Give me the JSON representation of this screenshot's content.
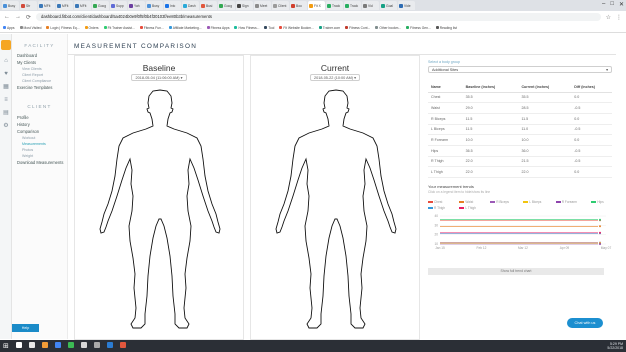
{
  "browser": {
    "tabs": [
      {
        "label": "Busy",
        "color": "#4a90d9",
        "active": false
      },
      {
        "label": "Str",
        "color": "#d24b3c",
        "active": false
      },
      {
        "label": "MFit",
        "color": "#3b78b8",
        "active": false
      },
      {
        "label": "MFit",
        "color": "#3b78b8",
        "active": false
      },
      {
        "label": "MFit",
        "color": "#3b78b8",
        "active": false
      },
      {
        "label": "Goog",
        "color": "#34a853",
        "active": false
      },
      {
        "label": "Supp",
        "color": "#5f6bd6",
        "active": false
      },
      {
        "label": "Yah",
        "color": "#6b3fa0",
        "active": false
      },
      {
        "label": "Busy",
        "color": "#4a90d9",
        "active": false
      },
      {
        "label": "Intc",
        "color": "#1a73e8",
        "active": false
      },
      {
        "label": "Dash",
        "color": "#29a9d8",
        "active": false
      },
      {
        "label": "Busi",
        "color": "#e1573d",
        "active": false
      },
      {
        "label": "Goog",
        "color": "#34a853",
        "active": false
      },
      {
        "label": "Sign",
        "color": "#444444",
        "active": false
      },
      {
        "label": "Meet",
        "color": "#8b8b8b",
        "active": false
      },
      {
        "label": "Client",
        "color": "#9a9a9a",
        "active": false
      },
      {
        "label": "Boo",
        "color": "#d13f2c",
        "active": false
      },
      {
        "label": "Fit X",
        "color": "#f39c12",
        "active": true
      },
      {
        "label": "Track",
        "color": "#27ae60",
        "active": false
      },
      {
        "label": "Track",
        "color": "#27ae60",
        "active": false
      },
      {
        "label": "Vid",
        "color": "#7a7a7a",
        "active": false
      },
      {
        "label": "Goal",
        "color": "#16a085",
        "active": false
      },
      {
        "label": "Vide",
        "color": "#2d6cb3",
        "active": false
      }
    ],
    "url": "dashboard.fitbot.com/client/dashboard/5a4024b0e9f0f5f0b4f30103f/ee80b3b/measurements",
    "bookmarks": [
      "Apps",
      "Most Visited",
      "Login | Fitness Eq...",
      "Orders",
      "Fit Trainer Assist...",
      "Fitness Fun...",
      "Affiliate Marketing...",
      "Fitness Apps",
      "How Fitness...",
      "Tool",
      "Fit Website Bookm...",
      "Trainer.com",
      "Fitness Cont...",
      "Other bookm...",
      "Fitness Gen...",
      "Reading list"
    ]
  },
  "sidebar": {
    "facility_heading": "FACILITY",
    "facility_items": [
      {
        "label": "Dashboard",
        "subs": []
      },
      {
        "label": "My Clients",
        "subs": [
          "View Clients",
          "Client Report",
          "Client Compliance"
        ]
      },
      {
        "label": "Exercise Templates",
        "subs": []
      }
    ],
    "client_heading": "CLIENT",
    "client_items": [
      {
        "label": "Profile",
        "subs": []
      },
      {
        "label": "History",
        "subs": []
      },
      {
        "label": "Comparison",
        "subs": [
          "Workout",
          "Measurements",
          "Photos",
          "Weight"
        ]
      },
      {
        "label": "Download Measurements",
        "subs": []
      }
    ],
    "selected_sub": "Measurements",
    "help_label": "Help"
  },
  "page": {
    "title": "MEASUREMENT COMPARISON",
    "baseline": {
      "title": "Baseline",
      "date": "2018-05-04 (11:06:00 AM) ▾"
    },
    "current": {
      "title": "Current",
      "date": "2018-05-22 (10:00 AM) ▾"
    }
  },
  "measurements": {
    "select_label": "Select a body group",
    "select_value": "Additional Sites",
    "columns": [
      "Name",
      "Baseline (inches)",
      "Current (inches)",
      "Diff (inches)"
    ],
    "rows": [
      {
        "name": "Chest",
        "baseline": "35.5",
        "current": "35.5",
        "diff": "0.0"
      },
      {
        "name": "Waist",
        "baseline": "29.0",
        "current": "28.5",
        "diff": "-0.5"
      },
      {
        "name": "R Biceps",
        "baseline": "11.5",
        "current": "11.5",
        "diff": "0.0"
      },
      {
        "name": "L Biceps",
        "baseline": "11.5",
        "current": "11.0",
        "diff": "-0.5"
      },
      {
        "name": "R Forearm",
        "baseline": "10.0",
        "current": "10.0",
        "diff": "0.0"
      },
      {
        "name": "Hips",
        "baseline": "36.5",
        "current": "36.0",
        "diff": "-0.5"
      },
      {
        "name": "R Thigh",
        "baseline": "22.0",
        "current": "21.5",
        "diff": "-0.5"
      },
      {
        "name": "L Thigh",
        "baseline": "22.0",
        "current": "22.0",
        "diff": "0.0"
      }
    ]
  },
  "trends": {
    "title": "Your measurement trends",
    "subtitle": "Click on a legend item to hide/show its line",
    "legend": [
      {
        "label": "Chest",
        "color": "#e74c3c"
      },
      {
        "label": "Waist",
        "color": "#e67e22"
      },
      {
        "label": "R Biceps",
        "color": "#9b59b6"
      },
      {
        "label": "L Biceps",
        "color": "#f1c40f"
      },
      {
        "label": "R Forearm",
        "color": "#8e44ad"
      },
      {
        "label": "Hips",
        "color": "#2ecc71"
      },
      {
        "label": "R Thigh",
        "color": "#3498db"
      },
      {
        "label": "L Thigh",
        "color": "#e91e63"
      }
    ],
    "x_labels": [
      "Jan 15",
      "Feb 12",
      "Mar 12",
      "Apr 09",
      "May 07"
    ],
    "y_labels": [
      "40",
      "30",
      "20",
      "10"
    ],
    "series_levels": [
      35.5,
      29.0,
      11.5,
      11.0,
      10.0,
      36.0,
      21.5,
      22.0
    ],
    "button_label": "Show full trend chart"
  },
  "chat_label": "Chat with us",
  "taskbar": {
    "icons": [
      "#ffffff",
      "#e8e8e8",
      "#f29d38",
      "#4285f4",
      "#3cba54",
      "#d7d7d7",
      "#aaaaaa",
      "#2b7cd3",
      "#e1573d"
    ],
    "time": "5:29 PM",
    "date": "5/22/2018"
  }
}
